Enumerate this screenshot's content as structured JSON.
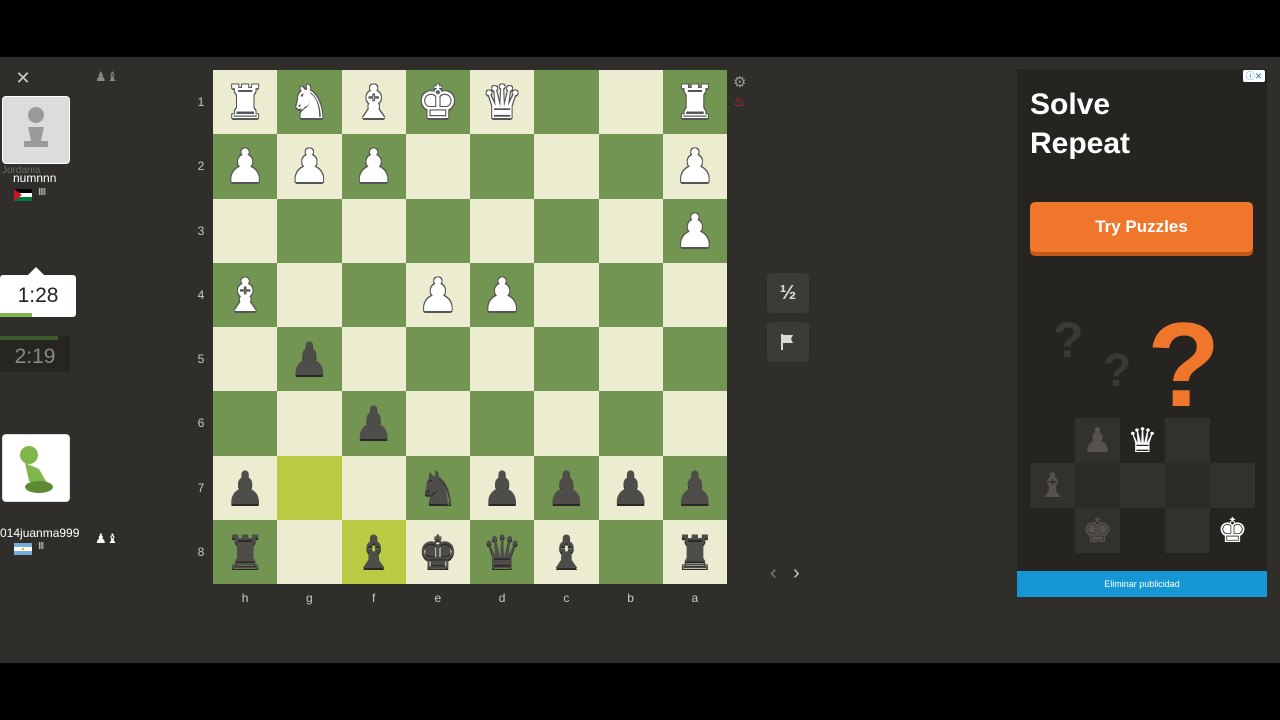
{
  "left_panel": {
    "close_icon": "close-icon",
    "top_player": {
      "country": "Jordania",
      "username": "numnnn",
      "connection_bars": "IIII",
      "captured_icons": "♟♝"
    },
    "active_clock": "1:28",
    "idle_clock": "2:19",
    "bottom_player": {
      "username": "014juanma999",
      "connection_bars": "III",
      "captured_icons": "♟♝"
    }
  },
  "board": {
    "orientation": "black-at-bottom",
    "ranks": [
      "1",
      "2",
      "3",
      "4",
      "5",
      "6",
      "7",
      "8"
    ],
    "files": [
      "h",
      "g",
      "f",
      "e",
      "d",
      "c",
      "b",
      "a"
    ],
    "highlighted_squares": [
      "g7",
      "f8"
    ],
    "position_rows_top_to_bottom": [
      [
        "wR",
        "wN",
        "wB",
        "wK",
        "wQ",
        "",
        "",
        "wR"
      ],
      [
        "wP",
        "wP",
        "wP",
        "",
        "",
        "",
        "",
        "wP"
      ],
      [
        "",
        "",
        "",
        "",
        "",
        "",
        "",
        "wP"
      ],
      [
        "wB",
        "",
        "",
        "wP",
        "wP",
        "",
        "",
        ""
      ],
      [
        "",
        "bP",
        "",
        "",
        "",
        "",
        "",
        ""
      ],
      [
        "",
        "",
        "bP",
        "",
        "",
        "",
        "",
        ""
      ],
      [
        "bP",
        "",
        "",
        "bN",
        "bP",
        "bP",
        "bP",
        "bP"
      ],
      [
        "bR",
        "",
        "bB",
        "bK",
        "bQ",
        "bB",
        "",
        "bR"
      ]
    ]
  },
  "controls": {
    "draw_label": "½",
    "resign_icon": "flag-icon",
    "settings_icon": "gear-icon",
    "alert_icon": "fire-icon",
    "prev_label": "‹",
    "next_label": "›"
  },
  "ad": {
    "headline_line1": "Solve",
    "headline_line2": "Repeat",
    "cta_label": "Try Puzzles",
    "remove_ads_label": "Eliminar publicidad"
  },
  "colors": {
    "light_square": "#ebecd0",
    "dark_square": "#739552",
    "highlight": "#b9ca43",
    "accent_orange": "#f0762b",
    "remove_ads_blue": "#1696d2"
  }
}
